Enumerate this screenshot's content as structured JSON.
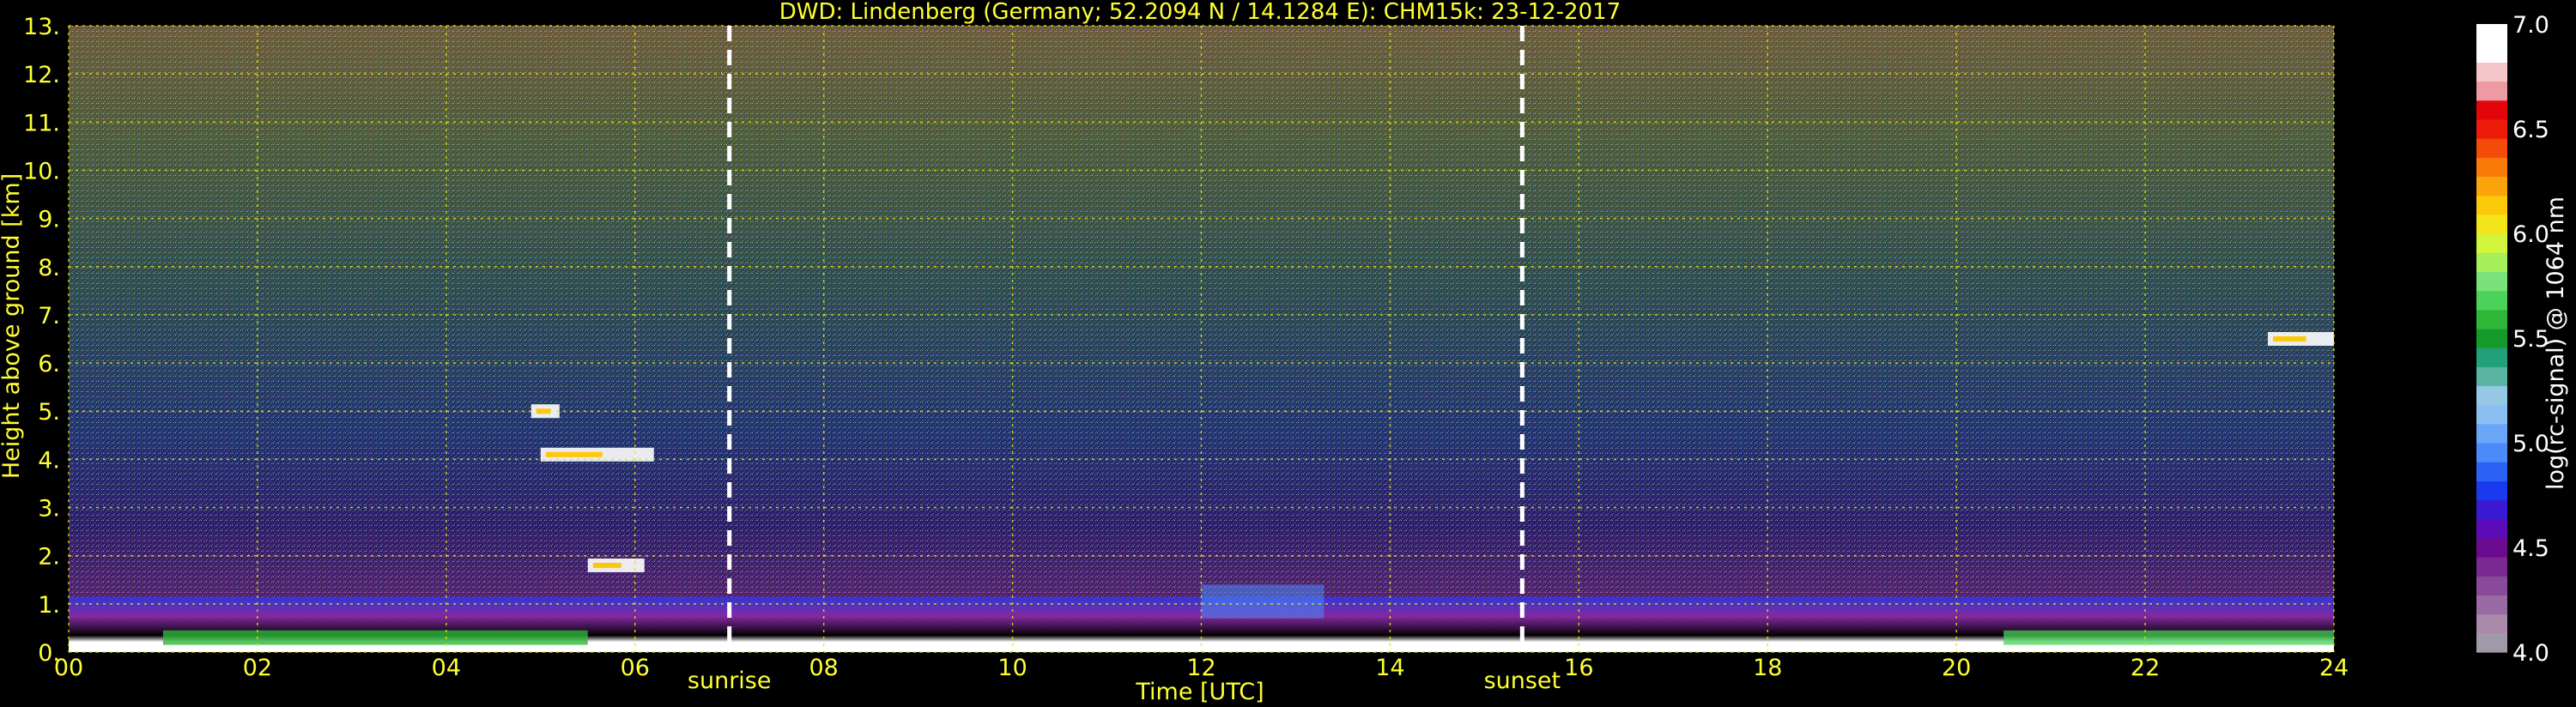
{
  "chart_data": {
    "type": "heatmap",
    "title": "DWD: Lindenberg (Germany; 52.2094 N / 14.1284 E):    CHM15k: 23-12-2017",
    "xlabel": "Time [UTC]",
    "ylabel": "Height above ground [km]",
    "x_range": [
      0,
      24
    ],
    "y_range": [
      0,
      13
    ],
    "x_ticks": [
      "00",
      "02",
      "04",
      "06",
      "08",
      "10",
      "12",
      "14",
      "16",
      "18",
      "20",
      "22",
      "24"
    ],
    "y_ticks": [
      "0.",
      "1.",
      "2.",
      "3.",
      "4.",
      "5.",
      "6.",
      "7.",
      "8.",
      "9.",
      "10.",
      "11.",
      "12.",
      "13."
    ],
    "grid": true,
    "events": [
      {
        "label": "sunrise",
        "time": 7.0
      },
      {
        "label": "sunset",
        "time": 15.4
      }
    ],
    "colorbar": {
      "label": "log(rc-signal) @ 1064 nm",
      "range": [
        4.0,
        7.0
      ],
      "ticks": [
        "4.0",
        "4.5",
        "5.0",
        "5.5",
        "6.0",
        "6.5",
        "7.0"
      ],
      "colors": [
        "#a09aa8",
        "#aa8aaa",
        "#9a6aa4",
        "#8a4a9a",
        "#7a2a92",
        "#6a0a8e",
        "#5a0ab6",
        "#3a1ad2",
        "#1a3af0",
        "#2a62f6",
        "#4a8afa",
        "#6aa6f8",
        "#8abef2",
        "#96c8e6",
        "#5ab4a2",
        "#22a07a",
        "#149a2a",
        "#2eb83a",
        "#4ad25a",
        "#7ae27a",
        "#a6ee5a",
        "#d2f43a",
        "#f4e41a",
        "#fcc80a",
        "#fca20a",
        "#fa7a0a",
        "#f44a0a",
        "#ee1a0a",
        "#e2060a",
        "#ee9aa2",
        "#f4c6ca",
        "#ffffff",
        "#ffffff"
      ]
    },
    "features": [
      {
        "type": "boundary_layer_aerosol",
        "t_start": 0.0,
        "t_end": 24.0,
        "height_top_km": 0.9
      },
      {
        "type": "cloud",
        "t_start": 5.0,
        "t_end": 6.2,
        "height_km": 4.1
      },
      {
        "type": "cloud",
        "t_start": 4.9,
        "t_end": 5.2,
        "height_km": 5.0
      },
      {
        "type": "cloud",
        "t_start": 5.5,
        "t_end": 6.1,
        "height_km": 1.8
      },
      {
        "type": "cloud",
        "t_start": 23.3,
        "t_end": 24.0,
        "height_km": 6.5
      }
    ]
  }
}
